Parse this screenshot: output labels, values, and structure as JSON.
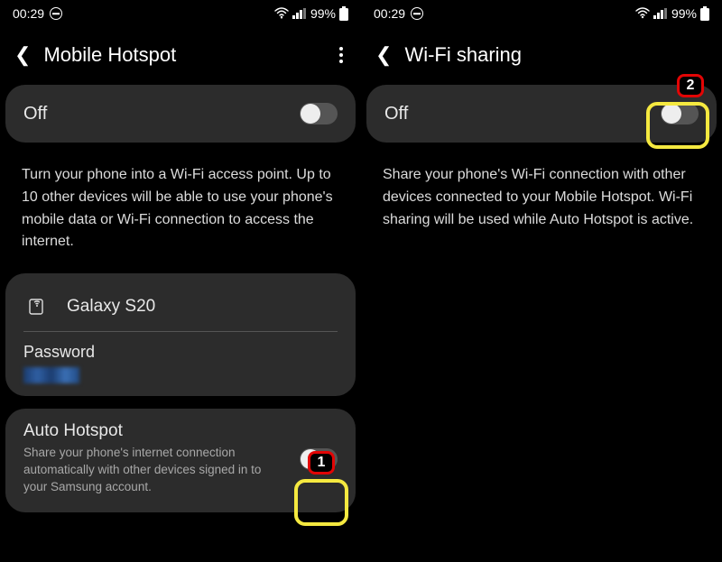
{
  "status": {
    "time": "00:29",
    "battery_pct": "99%"
  },
  "left": {
    "title": "Mobile Hotspot",
    "master_toggle": {
      "label": "Off",
      "on": false
    },
    "description": "Turn your phone into a Wi-Fi access point. Up to 10 other devices will be able to use your phone's mobile data or Wi-Fi connection to access the internet.",
    "network_name": "Galaxy S20",
    "password_label": "Password",
    "auto": {
      "title": "Auto Hotspot",
      "subtitle": "Share your phone's internet connection automatically with other devices signed in to your Samsung account.",
      "on": false
    },
    "callout": "1"
  },
  "right": {
    "title": "Wi-Fi sharing",
    "master_toggle": {
      "label": "Off",
      "on": false
    },
    "description": "Share your phone's Wi-Fi connection with other devices connected to your Mobile Hotspot. Wi-Fi sharing will be used while Auto Hotspot is active.",
    "callout": "2"
  }
}
